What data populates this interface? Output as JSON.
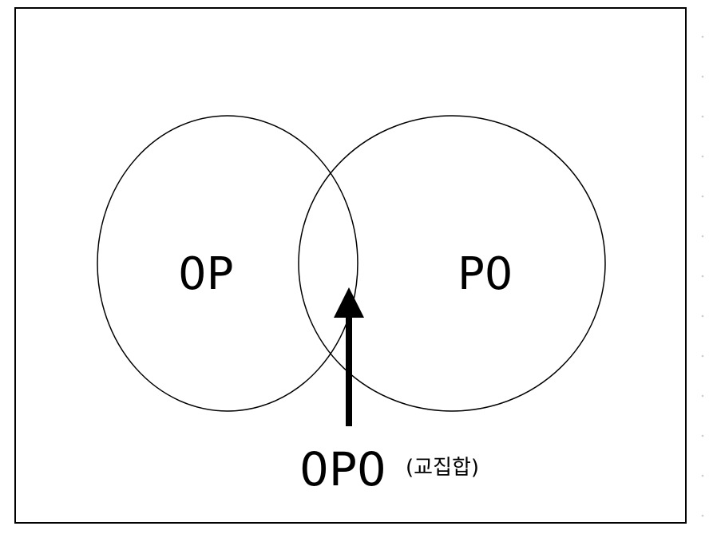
{
  "diagram": {
    "type": "venn",
    "left_set": {
      "label": "0P"
    },
    "right_set": {
      "label": "P0"
    },
    "intersection": {
      "label": "0P0",
      "note": "(교집합)"
    },
    "colors": {
      "stroke": "#000000",
      "background": "#ffffff",
      "arrow": "#000000"
    }
  }
}
